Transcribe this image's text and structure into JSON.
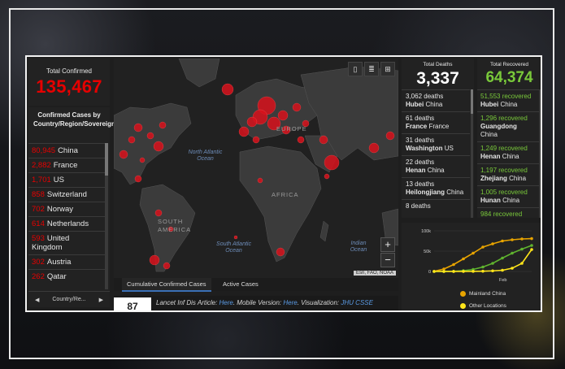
{
  "total_confirmed": {
    "label": "Total Confirmed",
    "value": "135,467"
  },
  "confirmed_by_region": {
    "title": "Confirmed Cases by Country/Region/Sovereignty",
    "items": [
      {
        "count": "80,945",
        "name": "China"
      },
      {
        "count": "2,882",
        "name": "France"
      },
      {
        "count": "1,701",
        "name": "US"
      },
      {
        "count": "858",
        "name": "Switzerland"
      },
      {
        "count": "702",
        "name": "Norway"
      },
      {
        "count": "614",
        "name": "Netherlands"
      },
      {
        "count": "593",
        "name": "United Kingdom"
      },
      {
        "count": "302",
        "name": "Austria"
      },
      {
        "count": "262",
        "name": "Qatar"
      }
    ],
    "pager_label": "Country/Re..."
  },
  "total_deaths": {
    "label": "Total Deaths",
    "value": "3,337"
  },
  "deaths": [
    {
      "count": "3,062 deaths",
      "region": "Hubei",
      "country": "China"
    },
    {
      "count": "61 deaths",
      "region": "France",
      "country": "France"
    },
    {
      "count": "31 deaths",
      "region": "Washington",
      "country": "US"
    },
    {
      "count": "22 deaths",
      "region": "Henan",
      "country": "China"
    },
    {
      "count": "13 deaths",
      "region": "Heilongjiang",
      "country": "China"
    },
    {
      "count": "8 deaths",
      "region": "",
      "country": ""
    }
  ],
  "total_recovered": {
    "label": "Total Recovered",
    "value": "64,374"
  },
  "recovered": [
    {
      "count": "51,553 recovered",
      "region": "Hubei",
      "country": "China"
    },
    {
      "count": "1,296 recovered",
      "region": "Guangdong",
      "country": "China"
    },
    {
      "count": "1,249 recovered",
      "region": "Henan",
      "country": "China"
    },
    {
      "count": "1,197 recovered",
      "region": "Zhejiang",
      "country": "China"
    },
    {
      "count": "1,005 recovered",
      "region": "Hunan",
      "country": "China"
    },
    {
      "count": "984 recovered",
      "region": "",
      "country": ""
    }
  ],
  "map": {
    "oceans": [
      "North Atlantic Ocean",
      "South Atlantic Ocean",
      "Indian Ocean"
    ],
    "continents": [
      "EUROPE",
      "AFRICA",
      "SOUTH AMERICA"
    ],
    "attribution": "Esri, FAO, NOAA",
    "zoom_in": "+",
    "zoom_out": "−",
    "toolbar": [
      "bookmark-icon",
      "list-icon",
      "grid-icon"
    ]
  },
  "tabs": [
    "Cumulative Confirmed Cases",
    "Active Cases"
  ],
  "lancet": {
    "prefix": "Lancet Inf Dis Article: ",
    "article_link": "Here",
    "mobile": ". Mobile Version: ",
    "mobile_link": "Here",
    "viz": ". Visualization: ",
    "viz_link": "JHU CSSE"
  },
  "bottom_left_peek": "87",
  "chart_data": {
    "type": "line",
    "yticks": [
      "100k",
      "50k",
      "0"
    ],
    "xlabel": "Feb",
    "ylim": [
      0,
      100000
    ],
    "series": [
      {
        "name": "Mainland China",
        "color": "#e8a400",
        "values": [
          500,
          6000,
          17000,
          31000,
          45000,
          60000,
          68000,
          75000,
          78000,
          80000,
          80900
        ]
      },
      {
        "name": "",
        "color": "#5fb32e",
        "values": [
          0,
          100,
          500,
          2000,
          5000,
          11000,
          20000,
          33000,
          45000,
          55000,
          64000
        ]
      },
      {
        "name": "Other Locations",
        "color": "#ffe51a",
        "values": [
          0,
          50,
          100,
          200,
          300,
          700,
          1500,
          3000,
          8000,
          20000,
          54000
        ]
      }
    ]
  }
}
